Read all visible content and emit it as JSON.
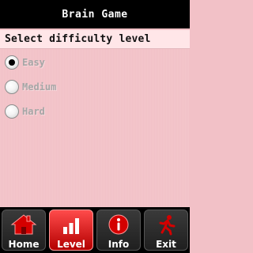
{
  "app": {
    "title": "Brain Game"
  },
  "header": {
    "prompt": "Select difficulty level"
  },
  "difficulty": {
    "options": [
      {
        "label": "Easy",
        "selected": true
      },
      {
        "label": "Medium",
        "selected": false
      },
      {
        "label": "Hard",
        "selected": false
      }
    ]
  },
  "tabs": [
    {
      "label": "Home",
      "icon": "house-icon",
      "active": false
    },
    {
      "label": "Level",
      "icon": "bar-chart-icon",
      "active": true
    },
    {
      "label": "Info",
      "icon": "info-icon",
      "active": false
    },
    {
      "label": "Exit",
      "icon": "running-person-icon",
      "active": false
    }
  ],
  "colors": {
    "background": "#f2c1c7",
    "header_bg": "#000000",
    "subheader_bg": "#ffe6e8",
    "accent_red": "#d40000",
    "disabled_text": "#a6a6a6"
  }
}
